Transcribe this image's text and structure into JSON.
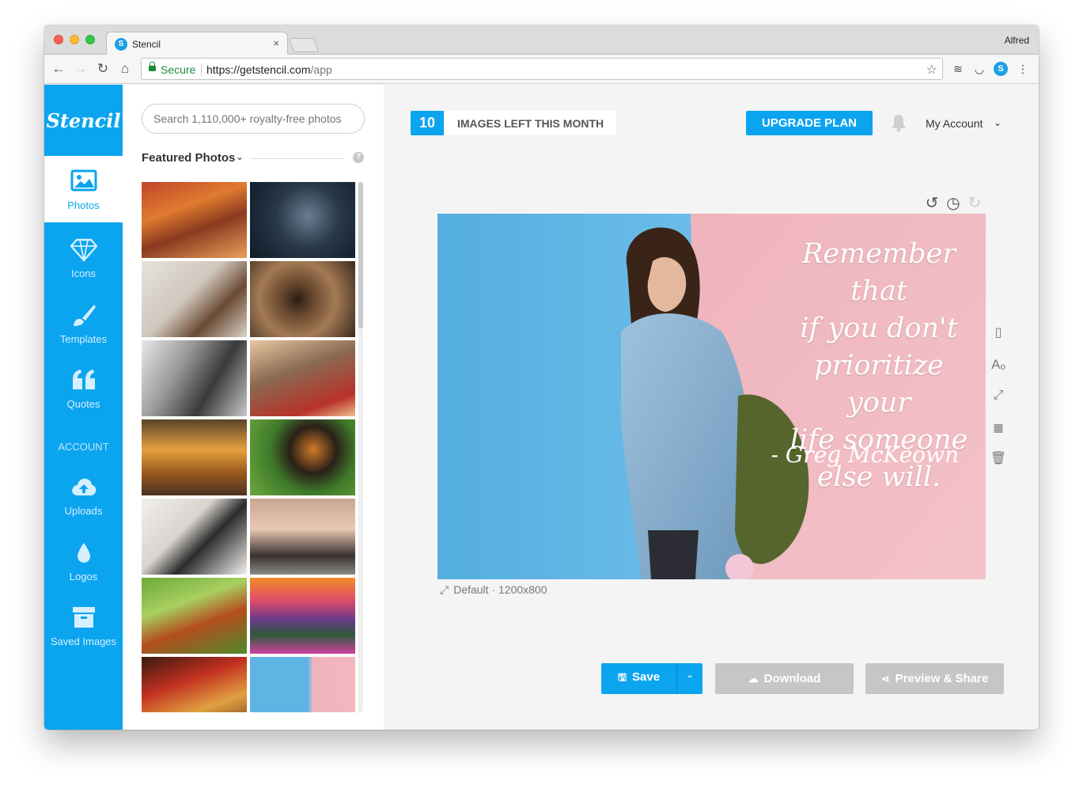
{
  "browser": {
    "tab_title": "Stencil",
    "tab_close": "×",
    "profile_name": "Alfred",
    "secure_label": "Secure",
    "url_host": "https://getstencil.com",
    "url_path": "/app"
  },
  "sidebar": {
    "logo": "Stencil",
    "items": [
      {
        "label": "Photos",
        "icon": "image-icon"
      },
      {
        "label": "Icons",
        "icon": "diamond-icon"
      },
      {
        "label": "Templates",
        "icon": "brush-icon"
      },
      {
        "label": "Quotes",
        "icon": "quote-icon"
      }
    ],
    "account_heading": "ACCOUNT",
    "account_items": [
      {
        "label": "Uploads",
        "icon": "cloud-upload-icon"
      },
      {
        "label": "Logos",
        "icon": "droplet-icon"
      },
      {
        "label": "Saved Images",
        "icon": "archive-icon"
      }
    ]
  },
  "photos": {
    "search_placeholder": "Search 1,110,000+ royalty-free photos",
    "featured_label": "Featured Photos",
    "help": "?"
  },
  "topbar": {
    "images_left_count": "10",
    "images_left_text": "IMAGES LEFT THIS MONTH",
    "upgrade_label": "UPGRADE PLAN",
    "account_label": "My Account"
  },
  "canvas": {
    "quote_lines": [
      "Remember that",
      "if you don't",
      "prioritize your",
      "life someone",
      "else will."
    ],
    "quote_author": "- Greg McKeown",
    "size_label": "Default · 1200x800"
  },
  "actions": {
    "save_label": "Save",
    "download_label": "Download",
    "share_label": "Preview & Share"
  },
  "colors": {
    "brand_blue": "#0ba4ef",
    "disabled_gray": "#c6c6c6"
  }
}
